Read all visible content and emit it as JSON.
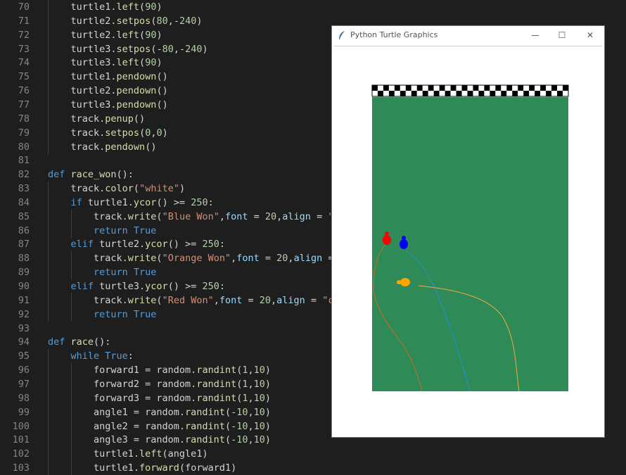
{
  "window": {
    "title": "Python Turtle Graphics",
    "minimize_label": "—",
    "maximize_label": "☐",
    "close_label": "✕"
  },
  "colors": {
    "track_green": "#2e8b57",
    "turtle_red": "#ff0000",
    "turtle_blue": "#0000ff",
    "turtle_orange": "#ffa500"
  },
  "lines": [
    {
      "n": "70",
      "indent": 1,
      "t": [
        [
          "turtle1.",
          "p"
        ],
        [
          "left",
          "f"
        ],
        [
          "(",
          "p"
        ],
        [
          "90",
          "n"
        ],
        [
          ")",
          "p"
        ]
      ]
    },
    {
      "n": "71",
      "indent": 1,
      "t": [
        [
          "turtle2.",
          "p"
        ],
        [
          "setpos",
          "f"
        ],
        [
          "(",
          "p"
        ],
        [
          "80",
          "n"
        ],
        [
          ",-",
          "p"
        ],
        [
          "240",
          "n"
        ],
        [
          ")",
          "p"
        ]
      ]
    },
    {
      "n": "72",
      "indent": 1,
      "t": [
        [
          "turtle2.",
          "p"
        ],
        [
          "left",
          "f"
        ],
        [
          "(",
          "p"
        ],
        [
          "90",
          "n"
        ],
        [
          ")",
          "p"
        ]
      ]
    },
    {
      "n": "73",
      "indent": 1,
      "t": [
        [
          "turtle3.",
          "p"
        ],
        [
          "setpos",
          "f"
        ],
        [
          "(-",
          "p"
        ],
        [
          "80",
          "n"
        ],
        [
          ",-",
          "p"
        ],
        [
          "240",
          "n"
        ],
        [
          ")",
          "p"
        ]
      ]
    },
    {
      "n": "74",
      "indent": 1,
      "t": [
        [
          "turtle3.",
          "p"
        ],
        [
          "left",
          "f"
        ],
        [
          "(",
          "p"
        ],
        [
          "90",
          "n"
        ],
        [
          ")",
          "p"
        ]
      ]
    },
    {
      "n": "75",
      "indent": 1,
      "t": [
        [
          "turtle1.",
          "p"
        ],
        [
          "pendown",
          "f"
        ],
        [
          "()",
          "p"
        ]
      ]
    },
    {
      "n": "76",
      "indent": 1,
      "t": [
        [
          "turtle2.",
          "p"
        ],
        [
          "pendown",
          "f"
        ],
        [
          "()",
          "p"
        ]
      ]
    },
    {
      "n": "77",
      "indent": 1,
      "t": [
        [
          "turtle3.",
          "p"
        ],
        [
          "pendown",
          "f"
        ],
        [
          "()",
          "p"
        ]
      ]
    },
    {
      "n": "78",
      "indent": 1,
      "t": [
        [
          "track.",
          "p"
        ],
        [
          "penup",
          "f"
        ],
        [
          "()",
          "p"
        ]
      ]
    },
    {
      "n": "79",
      "indent": 1,
      "t": [
        [
          "track.",
          "p"
        ],
        [
          "setpos",
          "f"
        ],
        [
          "(",
          "p"
        ],
        [
          "0",
          "n"
        ],
        [
          ",",
          "p"
        ],
        [
          "0",
          "n"
        ],
        [
          ")",
          "p"
        ]
      ]
    },
    {
      "n": "80",
      "indent": 1,
      "t": [
        [
          "track.",
          "p"
        ],
        [
          "pendown",
          "f"
        ],
        [
          "()",
          "p"
        ]
      ]
    },
    {
      "n": "81",
      "indent": 0,
      "t": []
    },
    {
      "n": "82",
      "indent": 0,
      "t": [
        [
          "def ",
          "k"
        ],
        [
          "race_won",
          "f"
        ],
        [
          "():",
          "p"
        ]
      ]
    },
    {
      "n": "83",
      "indent": 1,
      "t": [
        [
          "track.",
          "p"
        ],
        [
          "color",
          "f"
        ],
        [
          "(",
          "p"
        ],
        [
          "\"white\"",
          "s"
        ],
        [
          ")",
          "p"
        ]
      ]
    },
    {
      "n": "84",
      "indent": 1,
      "t": [
        [
          "if ",
          "k"
        ],
        [
          "turtle1.",
          "p"
        ],
        [
          "ycor",
          "f"
        ],
        [
          "() >= ",
          "p"
        ],
        [
          "250",
          "n"
        ],
        [
          ":",
          "p"
        ]
      ]
    },
    {
      "n": "85",
      "indent": 2,
      "t": [
        [
          "track.",
          "p"
        ],
        [
          "write",
          "f"
        ],
        [
          "(",
          "p"
        ],
        [
          "\"Blue Won\"",
          "s"
        ],
        [
          ",",
          "p"
        ],
        [
          "font",
          "a"
        ],
        [
          " = ",
          "p"
        ],
        [
          "20",
          "n"
        ],
        [
          ",",
          "p"
        ],
        [
          "align",
          "a"
        ],
        [
          " = ",
          "p"
        ],
        [
          "\"c",
          "s"
        ]
      ]
    },
    {
      "n": "86",
      "indent": 2,
      "t": [
        [
          "return ",
          "k"
        ],
        [
          "True",
          "b"
        ]
      ]
    },
    {
      "n": "87",
      "indent": 1,
      "t": [
        [
          "elif ",
          "k"
        ],
        [
          "turtle2.",
          "p"
        ],
        [
          "ycor",
          "f"
        ],
        [
          "() >= ",
          "p"
        ],
        [
          "250",
          "n"
        ],
        [
          ":",
          "p"
        ]
      ]
    },
    {
      "n": "88",
      "indent": 2,
      "t": [
        [
          "track.",
          "p"
        ],
        [
          "write",
          "f"
        ],
        [
          "(",
          "p"
        ],
        [
          "\"Orange Won\"",
          "s"
        ],
        [
          ",",
          "p"
        ],
        [
          "font",
          "a"
        ],
        [
          " = ",
          "p"
        ],
        [
          "20",
          "n"
        ],
        [
          ",",
          "p"
        ],
        [
          "align",
          "a"
        ],
        [
          " = ",
          "p"
        ]
      ]
    },
    {
      "n": "89",
      "indent": 2,
      "t": [
        [
          "return ",
          "k"
        ],
        [
          "True",
          "b"
        ]
      ]
    },
    {
      "n": "90",
      "indent": 1,
      "t": [
        [
          "elif ",
          "k"
        ],
        [
          "turtle3.",
          "p"
        ],
        [
          "ycor",
          "f"
        ],
        [
          "() >= ",
          "p"
        ],
        [
          "250",
          "n"
        ],
        [
          ":",
          "p"
        ]
      ]
    },
    {
      "n": "91",
      "indent": 2,
      "t": [
        [
          "track.",
          "p"
        ],
        [
          "write",
          "f"
        ],
        [
          "(",
          "p"
        ],
        [
          "\"Red Won\"",
          "s"
        ],
        [
          ",",
          "p"
        ],
        [
          "font",
          "a"
        ],
        [
          " = ",
          "p"
        ],
        [
          "20",
          "n"
        ],
        [
          ",",
          "p"
        ],
        [
          "align",
          "a"
        ],
        [
          " = ",
          "p"
        ],
        [
          "\"ce",
          "s"
        ]
      ]
    },
    {
      "n": "92",
      "indent": 2,
      "t": [
        [
          "return ",
          "k"
        ],
        [
          "True",
          "b"
        ]
      ]
    },
    {
      "n": "93",
      "indent": 0,
      "t": []
    },
    {
      "n": "94",
      "indent": 0,
      "t": [
        [
          "def ",
          "k"
        ],
        [
          "race",
          "f"
        ],
        [
          "():",
          "p"
        ]
      ]
    },
    {
      "n": "95",
      "indent": 1,
      "t": [
        [
          "while ",
          "k"
        ],
        [
          "True",
          "b"
        ],
        [
          ":",
          "p"
        ]
      ]
    },
    {
      "n": "96",
      "indent": 2,
      "t": [
        [
          "forward1 = random.",
          "p"
        ],
        [
          "randint",
          "f"
        ],
        [
          "(",
          "p"
        ],
        [
          "1",
          "n"
        ],
        [
          ",",
          "p"
        ],
        [
          "10",
          "n"
        ],
        [
          ")",
          "p"
        ]
      ]
    },
    {
      "n": "97",
      "indent": 2,
      "t": [
        [
          "forward2 = random.",
          "p"
        ],
        [
          "randint",
          "f"
        ],
        [
          "(",
          "p"
        ],
        [
          "1",
          "n"
        ],
        [
          ",",
          "p"
        ],
        [
          "10",
          "n"
        ],
        [
          ")",
          "p"
        ]
      ]
    },
    {
      "n": "98",
      "indent": 2,
      "t": [
        [
          "forward3 = random.",
          "p"
        ],
        [
          "randint",
          "f"
        ],
        [
          "(",
          "p"
        ],
        [
          "1",
          "n"
        ],
        [
          ",",
          "p"
        ],
        [
          "10",
          "n"
        ],
        [
          ")",
          "p"
        ]
      ]
    },
    {
      "n": "99",
      "indent": 2,
      "t": [
        [
          "angle1 = random.",
          "p"
        ],
        [
          "randint",
          "f"
        ],
        [
          "(-",
          "p"
        ],
        [
          "10",
          "n"
        ],
        [
          ",",
          "p"
        ],
        [
          "10",
          "n"
        ],
        [
          ")",
          "p"
        ]
      ]
    },
    {
      "n": "100",
      "indent": 2,
      "t": [
        [
          "angle2 = random.",
          "p"
        ],
        [
          "randint",
          "f"
        ],
        [
          "(-",
          "p"
        ],
        [
          "10",
          "n"
        ],
        [
          ",",
          "p"
        ],
        [
          "10",
          "n"
        ],
        [
          ")",
          "p"
        ]
      ]
    },
    {
      "n": "101",
      "indent": 2,
      "t": [
        [
          "angle3 = random.",
          "p"
        ],
        [
          "randint",
          "f"
        ],
        [
          "(-",
          "p"
        ],
        [
          "10",
          "n"
        ],
        [
          ",",
          "p"
        ],
        [
          "10",
          "n"
        ],
        [
          ")",
          "p"
        ]
      ]
    },
    {
      "n": "102",
      "indent": 2,
      "t": [
        [
          "turtle1.",
          "p"
        ],
        [
          "left",
          "f"
        ],
        [
          "(angle1)",
          "p"
        ]
      ]
    },
    {
      "n": "103",
      "indent": 2,
      "t": [
        [
          "turtle1.",
          "p"
        ],
        [
          "forward",
          "f"
        ],
        [
          "(forward1)",
          "p"
        ]
      ]
    }
  ]
}
